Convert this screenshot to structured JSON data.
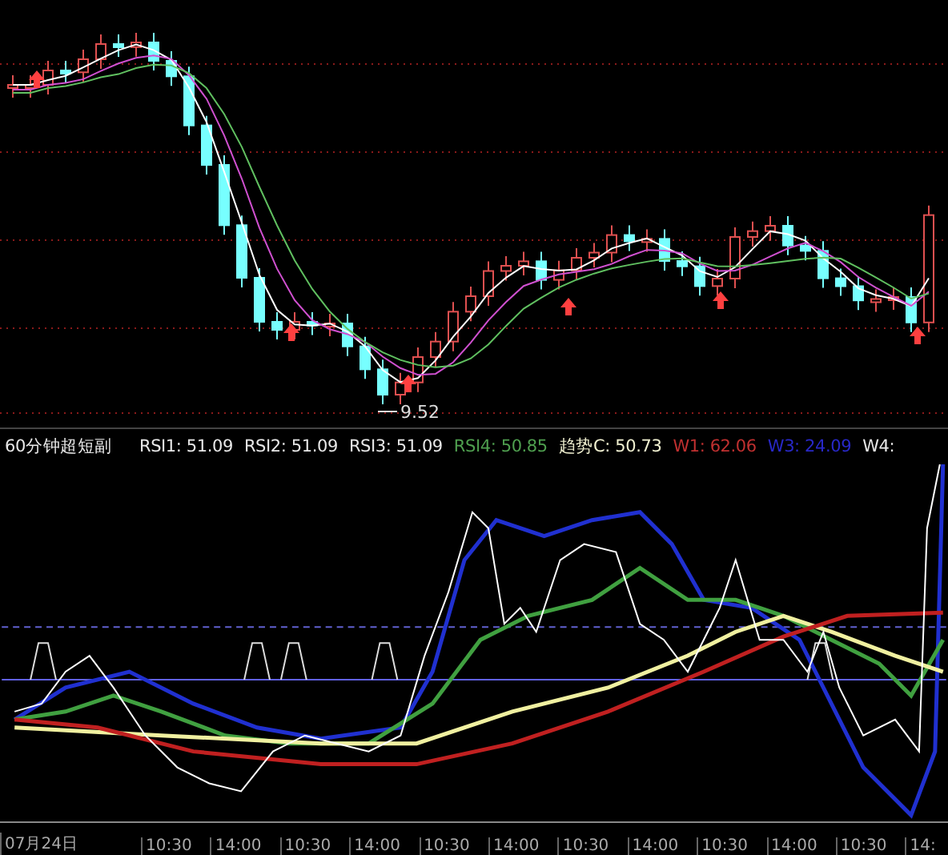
{
  "price_panel": {
    "low_label": "9.52"
  },
  "indicator_panel": {
    "title": "60分钟超短副",
    "readings": [
      {
        "label": "RSI1: 51.09",
        "color": "#e8e8e8"
      },
      {
        "label": "RSI2: 51.09",
        "color": "#e8e8e8"
      },
      {
        "label": "RSI3: 51.09",
        "color": "#e8e8e8"
      },
      {
        "label": "RSI4: 50.85",
        "color": "#4f9f4f"
      },
      {
        "label": "趋势C: 50.73",
        "color": "#f0f0d0"
      },
      {
        "label": "W1: 62.06",
        "color": "#c03030"
      },
      {
        "label": "W3: 24.09",
        "color": "#2828c8"
      },
      {
        "label": "W4:",
        "color": "#e8e8e8"
      }
    ]
  },
  "time_axis": {
    "labels": [
      "07月24日",
      "10:30",
      "14:00",
      "10:30",
      "14:00",
      "10:30",
      "14:00",
      "10:30",
      "14:00",
      "10:30",
      "14:00",
      "10:30",
      "14:"
    ]
  }
}
